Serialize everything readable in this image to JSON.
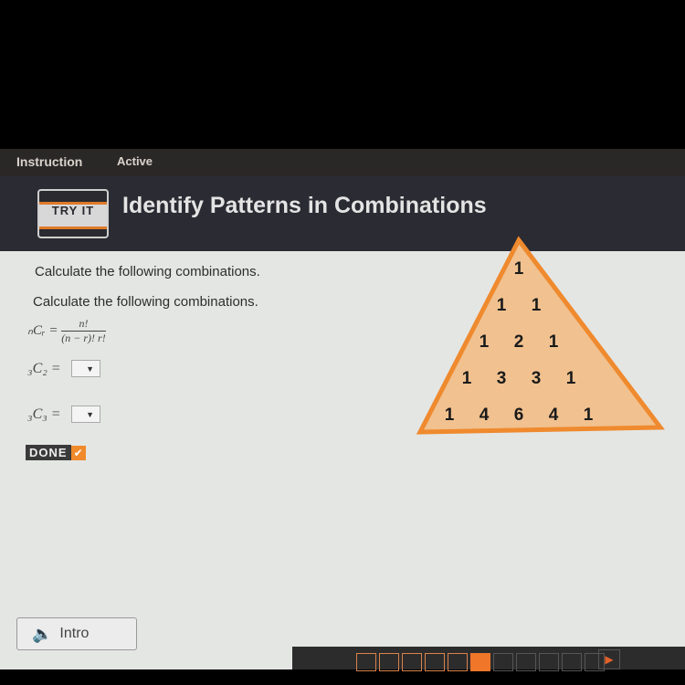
{
  "topbar": {
    "tab_instruction": "Instruction",
    "tab_active": "Active"
  },
  "header": {
    "badge": "TRY IT",
    "title": "Identify Patterns in Combinations"
  },
  "main": {
    "line1": "Calculate the following combinations.",
    "line2": "Calculate the following combinations.",
    "formula_lhs": "ₙCᵣ =",
    "formula_num": "n!",
    "formula_den": "(n − r)! r!",
    "rows": [
      {
        "lhs": "₃C₂ =",
        "value": ""
      },
      {
        "lhs": "₃C₃ =",
        "value": ""
      }
    ],
    "dropdown_arrow": "▼",
    "done_label": "DONE",
    "done_check": "✔"
  },
  "triangle": {
    "rows": [
      [
        "1"
      ],
      [
        "1",
        "1"
      ],
      [
        "1",
        "2",
        "1"
      ],
      [
        "1",
        "3",
        "3",
        "1"
      ],
      [
        "1",
        "4",
        "6",
        "4",
        "1"
      ]
    ],
    "fill": "#f1c18f",
    "stroke": "#ef8a2e"
  },
  "footer": {
    "intro_label": "Intro",
    "speaker_icon": "🔈",
    "progress": {
      "completed": 5,
      "current": 6,
      "total": 11
    },
    "next_icon": "▶"
  }
}
